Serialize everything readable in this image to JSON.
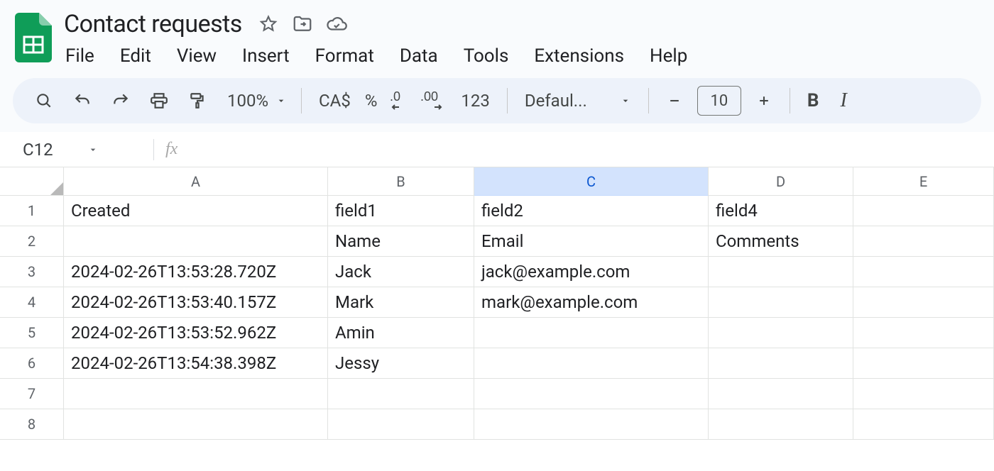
{
  "doc_title": "Contact requests",
  "menu": [
    "File",
    "Edit",
    "View",
    "Insert",
    "Format",
    "Data",
    "Tools",
    "Extensions",
    "Help"
  ],
  "toolbar": {
    "zoom": "100%",
    "currency": "CA$",
    "percent": "%",
    "decrease_decimal": ".0",
    "increase_decimal": ".00",
    "number_format": "123",
    "font_name": "Defaul...",
    "font_size": "10",
    "bold": "B",
    "italic": "I"
  },
  "namebox": "C12",
  "fx_label": "fx",
  "formula_value": "",
  "columns": [
    {
      "letter": "A",
      "cls": "cw-A",
      "active": false
    },
    {
      "letter": "B",
      "cls": "cw-B",
      "active": false
    },
    {
      "letter": "C",
      "cls": "cw-C",
      "active": true
    },
    {
      "letter": "D",
      "cls": "cw-D",
      "active": false
    },
    {
      "letter": "E",
      "cls": "cw-E",
      "active": false
    }
  ],
  "rows": [
    {
      "n": "1",
      "cells": [
        "Created",
        "field1",
        "field2",
        "field4",
        ""
      ]
    },
    {
      "n": "2",
      "cells": [
        "",
        "Name",
        "Email",
        "Comments",
        ""
      ]
    },
    {
      "n": "3",
      "cells": [
        "2024-02-26T13:53:28.720Z",
        "Jack",
        "jack@example.com",
        "",
        ""
      ]
    },
    {
      "n": "4",
      "cells": [
        "2024-02-26T13:53:40.157Z",
        "Mark",
        "mark@example.com",
        "",
        ""
      ]
    },
    {
      "n": "5",
      "cells": [
        "2024-02-26T13:53:52.962Z",
        "Amin",
        "",
        "",
        ""
      ]
    },
    {
      "n": "6",
      "cells": [
        "2024-02-26T13:54:38.398Z",
        "Jessy",
        "",
        "",
        ""
      ]
    },
    {
      "n": "7",
      "cells": [
        "",
        "",
        "",
        "",
        ""
      ]
    },
    {
      "n": "8",
      "cells": [
        "",
        "",
        "",
        "",
        ""
      ]
    }
  ]
}
